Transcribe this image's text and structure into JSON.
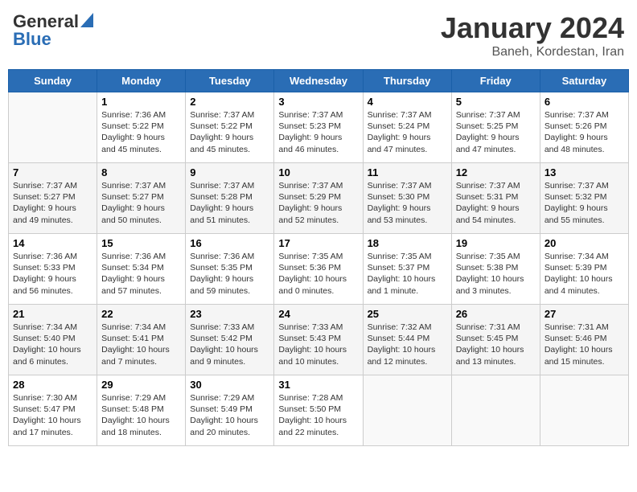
{
  "header": {
    "logo_general": "General",
    "logo_blue": "Blue",
    "month": "January 2024",
    "location": "Baneh, Kordestan, Iran"
  },
  "days_of_week": [
    "Sunday",
    "Monday",
    "Tuesday",
    "Wednesday",
    "Thursday",
    "Friday",
    "Saturday"
  ],
  "weeks": [
    [
      {
        "day": "",
        "sunrise": "",
        "sunset": "",
        "daylight": ""
      },
      {
        "day": "1",
        "sunrise": "Sunrise: 7:36 AM",
        "sunset": "Sunset: 5:22 PM",
        "daylight": "Daylight: 9 hours and 45 minutes."
      },
      {
        "day": "2",
        "sunrise": "Sunrise: 7:37 AM",
        "sunset": "Sunset: 5:22 PM",
        "daylight": "Daylight: 9 hours and 45 minutes."
      },
      {
        "day": "3",
        "sunrise": "Sunrise: 7:37 AM",
        "sunset": "Sunset: 5:23 PM",
        "daylight": "Daylight: 9 hours and 46 minutes."
      },
      {
        "day": "4",
        "sunrise": "Sunrise: 7:37 AM",
        "sunset": "Sunset: 5:24 PM",
        "daylight": "Daylight: 9 hours and 47 minutes."
      },
      {
        "day": "5",
        "sunrise": "Sunrise: 7:37 AM",
        "sunset": "Sunset: 5:25 PM",
        "daylight": "Daylight: 9 hours and 47 minutes."
      },
      {
        "day": "6",
        "sunrise": "Sunrise: 7:37 AM",
        "sunset": "Sunset: 5:26 PM",
        "daylight": "Daylight: 9 hours and 48 minutes."
      }
    ],
    [
      {
        "day": "7",
        "sunrise": "Sunrise: 7:37 AM",
        "sunset": "Sunset: 5:27 PM",
        "daylight": "Daylight: 9 hours and 49 minutes."
      },
      {
        "day": "8",
        "sunrise": "Sunrise: 7:37 AM",
        "sunset": "Sunset: 5:27 PM",
        "daylight": "Daylight: 9 hours and 50 minutes."
      },
      {
        "day": "9",
        "sunrise": "Sunrise: 7:37 AM",
        "sunset": "Sunset: 5:28 PM",
        "daylight": "Daylight: 9 hours and 51 minutes."
      },
      {
        "day": "10",
        "sunrise": "Sunrise: 7:37 AM",
        "sunset": "Sunset: 5:29 PM",
        "daylight": "Daylight: 9 hours and 52 minutes."
      },
      {
        "day": "11",
        "sunrise": "Sunrise: 7:37 AM",
        "sunset": "Sunset: 5:30 PM",
        "daylight": "Daylight: 9 hours and 53 minutes."
      },
      {
        "day": "12",
        "sunrise": "Sunrise: 7:37 AM",
        "sunset": "Sunset: 5:31 PM",
        "daylight": "Daylight: 9 hours and 54 minutes."
      },
      {
        "day": "13",
        "sunrise": "Sunrise: 7:37 AM",
        "sunset": "Sunset: 5:32 PM",
        "daylight": "Daylight: 9 hours and 55 minutes."
      }
    ],
    [
      {
        "day": "14",
        "sunrise": "Sunrise: 7:36 AM",
        "sunset": "Sunset: 5:33 PM",
        "daylight": "Daylight: 9 hours and 56 minutes."
      },
      {
        "day": "15",
        "sunrise": "Sunrise: 7:36 AM",
        "sunset": "Sunset: 5:34 PM",
        "daylight": "Daylight: 9 hours and 57 minutes."
      },
      {
        "day": "16",
        "sunrise": "Sunrise: 7:36 AM",
        "sunset": "Sunset: 5:35 PM",
        "daylight": "Daylight: 9 hours and 59 minutes."
      },
      {
        "day": "17",
        "sunrise": "Sunrise: 7:35 AM",
        "sunset": "Sunset: 5:36 PM",
        "daylight": "Daylight: 10 hours and 0 minutes."
      },
      {
        "day": "18",
        "sunrise": "Sunrise: 7:35 AM",
        "sunset": "Sunset: 5:37 PM",
        "daylight": "Daylight: 10 hours and 1 minute."
      },
      {
        "day": "19",
        "sunrise": "Sunrise: 7:35 AM",
        "sunset": "Sunset: 5:38 PM",
        "daylight": "Daylight: 10 hours and 3 minutes."
      },
      {
        "day": "20",
        "sunrise": "Sunrise: 7:34 AM",
        "sunset": "Sunset: 5:39 PM",
        "daylight": "Daylight: 10 hours and 4 minutes."
      }
    ],
    [
      {
        "day": "21",
        "sunrise": "Sunrise: 7:34 AM",
        "sunset": "Sunset: 5:40 PM",
        "daylight": "Daylight: 10 hours and 6 minutes."
      },
      {
        "day": "22",
        "sunrise": "Sunrise: 7:34 AM",
        "sunset": "Sunset: 5:41 PM",
        "daylight": "Daylight: 10 hours and 7 minutes."
      },
      {
        "day": "23",
        "sunrise": "Sunrise: 7:33 AM",
        "sunset": "Sunset: 5:42 PM",
        "daylight": "Daylight: 10 hours and 9 minutes."
      },
      {
        "day": "24",
        "sunrise": "Sunrise: 7:33 AM",
        "sunset": "Sunset: 5:43 PM",
        "daylight": "Daylight: 10 hours and 10 minutes."
      },
      {
        "day": "25",
        "sunrise": "Sunrise: 7:32 AM",
        "sunset": "Sunset: 5:44 PM",
        "daylight": "Daylight: 10 hours and 12 minutes."
      },
      {
        "day": "26",
        "sunrise": "Sunrise: 7:31 AM",
        "sunset": "Sunset: 5:45 PM",
        "daylight": "Daylight: 10 hours and 13 minutes."
      },
      {
        "day": "27",
        "sunrise": "Sunrise: 7:31 AM",
        "sunset": "Sunset: 5:46 PM",
        "daylight": "Daylight: 10 hours and 15 minutes."
      }
    ],
    [
      {
        "day": "28",
        "sunrise": "Sunrise: 7:30 AM",
        "sunset": "Sunset: 5:47 PM",
        "daylight": "Daylight: 10 hours and 17 minutes."
      },
      {
        "day": "29",
        "sunrise": "Sunrise: 7:29 AM",
        "sunset": "Sunset: 5:48 PM",
        "daylight": "Daylight: 10 hours and 18 minutes."
      },
      {
        "day": "30",
        "sunrise": "Sunrise: 7:29 AM",
        "sunset": "Sunset: 5:49 PM",
        "daylight": "Daylight: 10 hours and 20 minutes."
      },
      {
        "day": "31",
        "sunrise": "Sunrise: 7:28 AM",
        "sunset": "Sunset: 5:50 PM",
        "daylight": "Daylight: 10 hours and 22 minutes."
      },
      {
        "day": "",
        "sunrise": "",
        "sunset": "",
        "daylight": ""
      },
      {
        "day": "",
        "sunrise": "",
        "sunset": "",
        "daylight": ""
      },
      {
        "day": "",
        "sunrise": "",
        "sunset": "",
        "daylight": ""
      }
    ]
  ]
}
